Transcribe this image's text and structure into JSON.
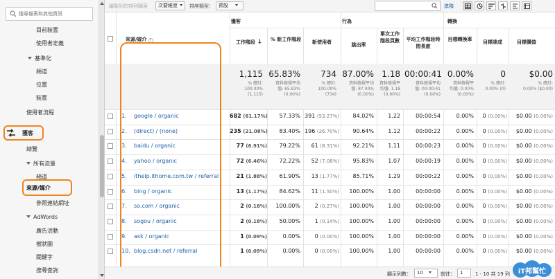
{
  "sidebar": {
    "search_placeholder": "搜尋報表和其他資訊",
    "items": {
      "goals_overview": "目前裝置",
      "custom_vars": "使用者定義",
      "benchmark": "基準化",
      "channels": "頻道",
      "location": "位置",
      "devices": "裝置",
      "user_flow": "使用者流程",
      "acquisition": "獲客",
      "overview": "總覽",
      "all_traffic": "所有流量",
      "channels2": "頻道",
      "source_medium": "來源/媒介",
      "referrals": "參照連結網址",
      "adwords": "AdWords",
      "campaigns": "廣告活動",
      "treemaps": "樹狀圖",
      "keywords": "關鍵字",
      "search_queries": "搜尋查詢"
    }
  },
  "toolbar": {
    "plot_rows": "繪製列的排列圖表",
    "secondary_dimension": "次要維度",
    "sort_type_label": "排序類型：",
    "sort_type_value": "預設",
    "advanced": "進階"
  },
  "table": {
    "groups": {
      "acquisition": "獲客",
      "behavior": "行為",
      "conversions": "轉換"
    },
    "dimension_header": "來源/媒介",
    "headers": {
      "sessions": "工作階段",
      "new_sessions_pct": "% 新工作階段",
      "new_users": "新使用者",
      "bounce_rate": "跳出率",
      "pages_per_session": "單次工作階段頁數",
      "avg_session_duration": "平均工作階段時間長度",
      "goal_conv_rate": "目標轉換率",
      "goal_completions": "目標達成",
      "goal_value": "目標價值"
    },
    "totals": {
      "sessions": "1,115",
      "sessions_sub1": "% 總計:",
      "sessions_sub2": "100.00%",
      "sessions_sub3": "(1,115)",
      "new_sessions_pct": "65.83%",
      "new_sessions_sub1": "資料檢視平均",
      "new_sessions_sub2": "值: 65.83%",
      "new_sessions_sub3": "(0.00%)",
      "new_users": "734",
      "new_users_sub1": "% 總計:",
      "new_users_sub2": "100.00%",
      "new_users_sub3": "(734)",
      "bounce_rate": "87.00%",
      "bounce_sub1": "資料檢視平均",
      "bounce_sub2": "值: 87.00%",
      "bounce_sub3": "(0.00%)",
      "pages": "1.18",
      "pages_sub1": "資料檢視平",
      "pages_sub2": "均值: 1.18",
      "pages_sub3": "(0.00%)",
      "duration": "00:00:41",
      "duration_sub1": "資料檢視平均",
      "duration_sub2": "值: 00:00:41",
      "duration_sub3": "(0.00%)",
      "conv_rate": "0.00%",
      "conv_sub1": "資料檢視平",
      "conv_sub2": "均值: 0.00%",
      "conv_sub3": "(0.00%)",
      "completions": "0",
      "comp_sub1": "% 總計:",
      "comp_sub2": "0.00% (0)",
      "value": "$0.00",
      "value_sub1": "% 總計:",
      "value_sub2": "0.00% ($0.00)"
    },
    "rows": [
      {
        "num": "1.",
        "source": "google / organic",
        "sessions": "682",
        "sessions_pct": "(61.17%)",
        "new_pct": "57.33%",
        "new_users": "391",
        "new_users_pct": "(53.27%)",
        "bounce": "84.02%",
        "pages": "1.22",
        "duration": "00:00:54",
        "conv": "0.00%",
        "comp": "0",
        "comp_pct": "(0.00%)",
        "value": "$0.00",
        "value_pct": "(0.00%)"
      },
      {
        "num": "2.",
        "source": "(direct) / (none)",
        "sessions": "235",
        "sessions_pct": "(21.08%)",
        "new_pct": "83.40%",
        "new_users": "196",
        "new_users_pct": "(26.70%)",
        "bounce": "90.64%",
        "pages": "1.12",
        "duration": "00:00:22",
        "conv": "0.00%",
        "comp": "0",
        "comp_pct": "(0.00%)",
        "value": "$0.00",
        "value_pct": "(0.00%)"
      },
      {
        "num": "3.",
        "source": "baidu / organic",
        "sessions": "77",
        "sessions_pct": "(6.91%)",
        "new_pct": "79.22%",
        "new_users": "61",
        "new_users_pct": "(8.31%)",
        "bounce": "92.21%",
        "pages": "1.11",
        "duration": "00:00:23",
        "conv": "0.00%",
        "comp": "0",
        "comp_pct": "(0.00%)",
        "value": "$0.00",
        "value_pct": "(0.00%)"
      },
      {
        "num": "4.",
        "source": "yahoo / organic",
        "sessions": "72",
        "sessions_pct": "(6.46%)",
        "new_pct": "72.22%",
        "new_users": "52",
        "new_users_pct": "(7.08%)",
        "bounce": "95.83%",
        "pages": "1.07",
        "duration": "00:00:19",
        "conv": "0.00%",
        "comp": "0",
        "comp_pct": "(0.00%)",
        "value": "$0.00",
        "value_pct": "(0.00%)"
      },
      {
        "num": "5.",
        "source": "ithelp.ithome.com.tw / referral",
        "sessions": "21",
        "sessions_pct": "(1.88%)",
        "new_pct": "61.90%",
        "new_users": "13",
        "new_users_pct": "(1.77%)",
        "bounce": "85.71%",
        "pages": "1.29",
        "duration": "00:00:22",
        "conv": "0.00%",
        "comp": "0",
        "comp_pct": "(0.00%)",
        "value": "$0.00",
        "value_pct": "(0.00%)"
      },
      {
        "num": "6.",
        "source": "bing / organic",
        "sessions": "13",
        "sessions_pct": "(1.17%)",
        "new_pct": "84.62%",
        "new_users": "11",
        "new_users_pct": "(1.50%)",
        "bounce": "100.00%",
        "pages": "1.00",
        "duration": "00:00:00",
        "conv": "0.00%",
        "comp": "0",
        "comp_pct": "(0.00%)",
        "value": "$0.00",
        "value_pct": "(0.00%)"
      },
      {
        "num": "7.",
        "source": "so.com / organic",
        "sessions": "2",
        "sessions_pct": "(0.18%)",
        "new_pct": "100.00%",
        "new_users": "2",
        "new_users_pct": "(0.27%)",
        "bounce": "100.00%",
        "pages": "1.00",
        "duration": "00:00:00",
        "conv": "0.00%",
        "comp": "0",
        "comp_pct": "(0.00%)",
        "value": "$0.00",
        "value_pct": "(0.00%)"
      },
      {
        "num": "8.",
        "source": "sogou / organic",
        "sessions": "2",
        "sessions_pct": "(0.18%)",
        "new_pct": "50.00%",
        "new_users": "1",
        "new_users_pct": "(0.14%)",
        "bounce": "100.00%",
        "pages": "1.00",
        "duration": "00:00:00",
        "conv": "0.00%",
        "comp": "0",
        "comp_pct": "(0.00%)",
        "value": "$0.00",
        "value_pct": "(0.00%)"
      },
      {
        "num": "9.",
        "source": "ask / organic",
        "sessions": "1",
        "sessions_pct": "(0.09%)",
        "new_pct": "0.00%",
        "new_users": "0",
        "new_users_pct": "(0.00%)",
        "bounce": "100.00%",
        "pages": "1.00",
        "duration": "00:00:00",
        "conv": "0.00%",
        "comp": "0",
        "comp_pct": "(0.00%)",
        "value": "$0.00",
        "value_pct": "(0.00%)"
      },
      {
        "num": "10.",
        "source": "blog.csdn.net / referral",
        "sessions": "1",
        "sessions_pct": "(0.09%)",
        "new_pct": "0.00%",
        "new_users": "0",
        "new_users_pct": "(0.00%)",
        "bounce": "100.00%",
        "pages": "1.00",
        "duration": "00:00:00",
        "conv": "0.00%",
        "comp": "0",
        "comp_pct": "(0.00%)",
        "value": "$0.00",
        "value_pct": "(0.00%)"
      }
    ]
  },
  "footer": {
    "rows_label": "顯示列數：",
    "rows_value": "10",
    "goto_label": "前往：",
    "goto_value": "1",
    "range": "1 - 10 共 19 列"
  },
  "logo": {
    "text": "iT邦幫忙"
  },
  "colors": {
    "highlight": "#f0821e",
    "link": "#1a5fa8",
    "brand": "#3b8fd6"
  }
}
